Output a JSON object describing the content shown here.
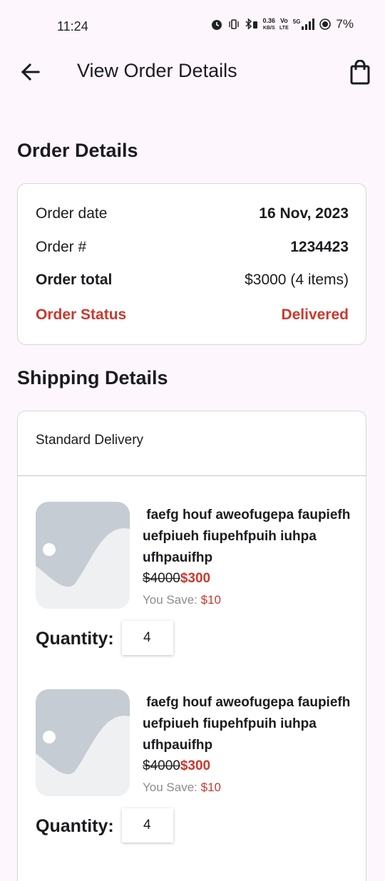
{
  "status_bar": {
    "time": "11:24",
    "net_speed": "0.36",
    "net_unit": "KB/S",
    "volte": "Vo",
    "lte": "LTE",
    "network": "5G",
    "battery": "7%"
  },
  "app_bar": {
    "title": "View Order Details",
    "back_icon": "arrow-back-icon",
    "bag_icon": "shopping-bag-icon"
  },
  "order_details": {
    "heading": "Order Details",
    "rows": [
      {
        "label": "Order date",
        "value": "16 Nov, 2023"
      },
      {
        "label": "Order #",
        "value": "1234423"
      },
      {
        "label": "Order total",
        "value": "$3000 (4 items)"
      },
      {
        "label": "Order Status",
        "value": "Delivered"
      }
    ]
  },
  "shipping_details": {
    "heading": "Shipping Details",
    "delivery_method": "Standard Delivery",
    "items": [
      {
        "name": " faefg houf aweofugepa faupiefh uefpiueh fiupehfpuih iuhpa ufhpauifhp",
        "old_price": "$4000",
        "new_price": "$300",
        "save_label": "You Save: ",
        "save_amount": "$10",
        "quantity_label": "Quantity:",
        "quantity": "4"
      },
      {
        "name": " faefg houf aweofugepa faupiefh uefpiueh fiupehfpuih iuhpa ufhpauifhp",
        "old_price": "$4000",
        "new_price": "$300",
        "save_label": "You Save: ",
        "save_amount": "$10",
        "quantity_label": "Quantity:",
        "quantity": "4"
      }
    ]
  },
  "colors": {
    "background": "#fdf7fd",
    "accent_red": "#c9392d",
    "muted_text": "#8d8a90",
    "placeholder_image": "#c5ccd3"
  }
}
